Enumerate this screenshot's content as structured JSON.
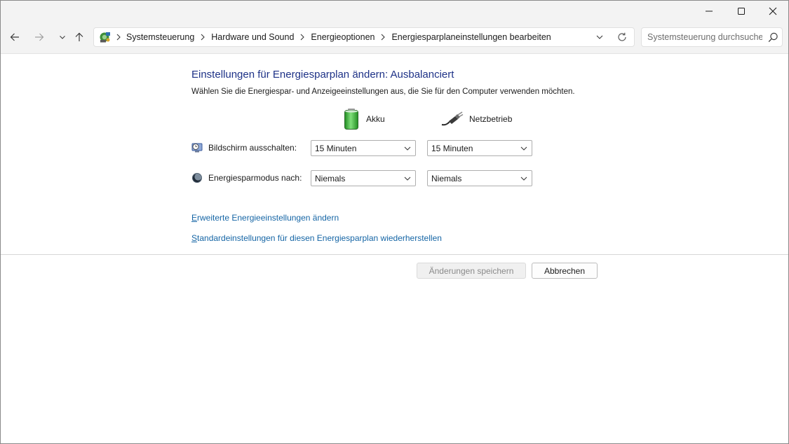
{
  "window": {
    "controls": {
      "minimize": "minimize-icon",
      "maximize": "maximize-icon",
      "close": "close-icon"
    }
  },
  "toolbar": {
    "nav": {
      "back": "arrow-left-icon",
      "forward": "arrow-right-icon",
      "recent": "chevron-down-icon",
      "up": "arrow-up-icon"
    },
    "breadcrumb": [
      "Systemsteuerung",
      "Hardware und Sound",
      "Energieoptionen",
      "Energiesparplaneinstellungen bearbeiten"
    ],
    "search": {
      "placeholder": "Systemsteuerung durchsuchen",
      "value": ""
    }
  },
  "main": {
    "title": "Einstellungen für Energiesparplan ändern: Ausbalanciert",
    "description": "Wählen Sie die Energiespar- und Anzeigeeinstellungen aus, die Sie für den Computer verwenden möchten.",
    "columns": {
      "battery": "Akku",
      "power": "Netzbetrieb"
    },
    "rows": [
      {
        "label": "Bildschirm ausschalten:",
        "battery_value": "15 Minuten",
        "power_value": "15 Minuten"
      },
      {
        "label": "Energiesparmodus nach:",
        "battery_value": "Niemals",
        "power_value": "Niemals"
      }
    ],
    "links": {
      "advanced_first": "E",
      "advanced_rest": "rweiterte Energieeinstellungen ändern",
      "restore_first": "S",
      "restore_rest": "tandardeinstellungen für diesen Energiesparplan wiederherstellen"
    },
    "buttons": {
      "save": "Änderungen speichern",
      "cancel": "Abbrechen"
    }
  },
  "colors": {
    "title": "#1e3287",
    "link": "#1565a5",
    "battery_green": "#3db13d"
  }
}
